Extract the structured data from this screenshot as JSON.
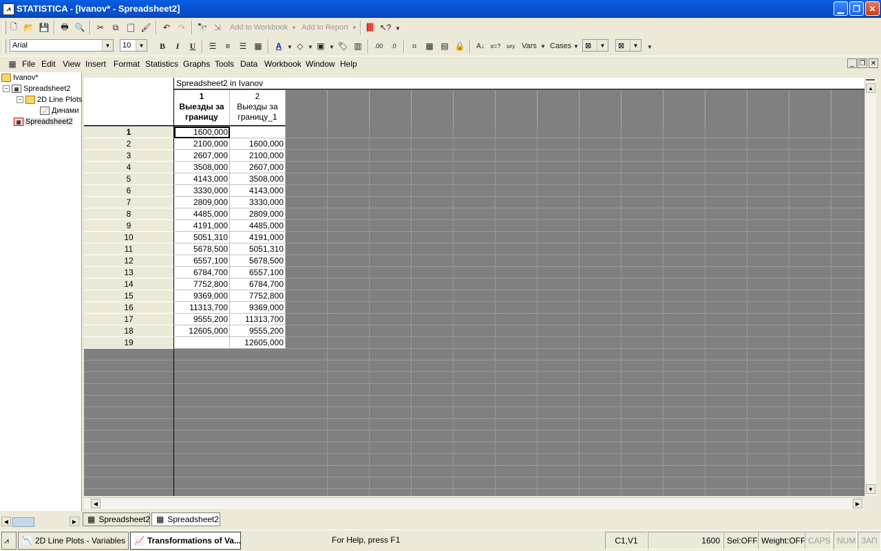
{
  "window": {
    "title": "STATISTICA - [Ivanov* - Spreadsheet2]"
  },
  "toolbar1": {
    "add_to_workbook": "Add to Workbook",
    "add_to_report": "Add to Report"
  },
  "toolbar2": {
    "font_name": "Arial",
    "font_size": "10",
    "bold": "B",
    "italic": "I",
    "underline": "U",
    "vars": "Vars",
    "cases": "Cases"
  },
  "menu": {
    "items": [
      "File",
      "Edit",
      "View",
      "Insert",
      "Format",
      "Statistics",
      "Graphs",
      "Tools",
      "Data",
      "Workbook",
      "Window",
      "Help"
    ]
  },
  "tree": {
    "root": "Ivanov*",
    "spreadsheet1": "Spreadsheet2",
    "folder": "2D Line Plots",
    "graph": "Динами",
    "spreadsheet2": "Spreadsheet2"
  },
  "spreadsheet": {
    "title": "Spreadsheet2 in Ivanov",
    "columns": [
      {
        "num": "1",
        "name_line1": "Выезды за",
        "name_line2": "границу"
      },
      {
        "num": "2",
        "name_line1": "Выезды за",
        "name_line2": "границу_1"
      }
    ],
    "rows": [
      {
        "id": "1",
        "c1": "1600,000",
        "c2": ""
      },
      {
        "id": "2",
        "c1": "2100,000",
        "c2": "1600,000"
      },
      {
        "id": "3",
        "c1": "2607,000",
        "c2": "2100,000"
      },
      {
        "id": "4",
        "c1": "3508,000",
        "c2": "2607,000"
      },
      {
        "id": "5",
        "c1": "4143,000",
        "c2": "3508,000"
      },
      {
        "id": "6",
        "c1": "3330,000",
        "c2": "4143,000"
      },
      {
        "id": "7",
        "c1": "2809,000",
        "c2": "3330,000"
      },
      {
        "id": "8",
        "c1": "4485,000",
        "c2": "2809,000"
      },
      {
        "id": "9",
        "c1": "4191,000",
        "c2": "4485,000"
      },
      {
        "id": "10",
        "c1": "5051,310",
        "c2": "4191,000"
      },
      {
        "id": "11",
        "c1": "5678,500",
        "c2": "5051,310"
      },
      {
        "id": "12",
        "c1": "6557,100",
        "c2": "5678,500"
      },
      {
        "id": "13",
        "c1": "6784,700",
        "c2": "6557,100"
      },
      {
        "id": "14",
        "c1": "7752,800",
        "c2": "6784,700"
      },
      {
        "id": "15",
        "c1": "9369,000",
        "c2": "7752,800"
      },
      {
        "id": "16",
        "c1": "11313,700",
        "c2": "9369,000"
      },
      {
        "id": "17",
        "c1": "9555,200",
        "c2": "11313,700"
      },
      {
        "id": "18",
        "c1": "12605,000",
        "c2": "9555,200"
      },
      {
        "id": "19",
        "c1": "",
        "c2": "12605,000"
      }
    ]
  },
  "tabs": [
    "Spreadsheet2",
    "Spreadsheet2"
  ],
  "taskbar": {
    "item1": "2D Line Plots - Variables",
    "item2": "Transformations of Va..."
  },
  "status": {
    "help": "For Help, press F1",
    "cell": "C1,V1",
    "value": "1600",
    "sel": "Sel:OFF",
    "weight": "Weight:OFF",
    "caps": "CAPS",
    "num": "NUM",
    "zap": "ЗАП"
  }
}
